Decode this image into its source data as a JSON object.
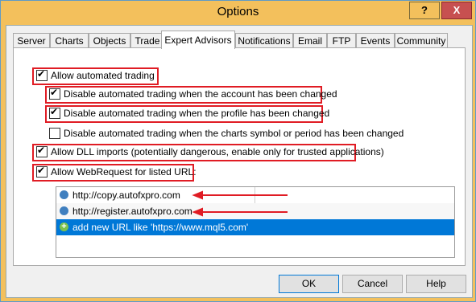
{
  "window": {
    "title": "Options",
    "help_label": "?",
    "close_label": "X"
  },
  "tabs": [
    {
      "label": "Server"
    },
    {
      "label": "Charts"
    },
    {
      "label": "Objects"
    },
    {
      "label": "Trade"
    },
    {
      "label": "Expert Advisors"
    },
    {
      "label": "Notifications"
    },
    {
      "label": "Email"
    },
    {
      "label": "FTP"
    },
    {
      "label": "Events"
    },
    {
      "label": "Community"
    }
  ],
  "active_tab": "Expert Advisors",
  "options": [
    {
      "label": "Allow automated trading",
      "checked": true
    },
    {
      "label": "Disable automated trading when the account has been changed",
      "checked": true
    },
    {
      "label": "Disable automated trading when the profile has been changed",
      "checked": true
    },
    {
      "label": "Disable automated trading when the charts symbol or period has been changed",
      "checked": false
    },
    {
      "label": "Allow DLL imports (potentially dangerous, enable only for trusted applications)",
      "checked": true
    },
    {
      "label": "Allow WebRequest for listed URL:",
      "checked": true
    }
  ],
  "urls": [
    {
      "text": "http://copy.autofxpro.com"
    },
    {
      "text": "http://register.autofxpro.com"
    },
    {
      "text": "add new URL like 'https://www.mql5.com'"
    }
  ],
  "buttons": {
    "ok": "OK",
    "cancel": "Cancel",
    "help": "Help"
  },
  "colors": {
    "titlebar": "#f3c05c",
    "highlight": "#e01c24",
    "selection": "#0078d7"
  }
}
